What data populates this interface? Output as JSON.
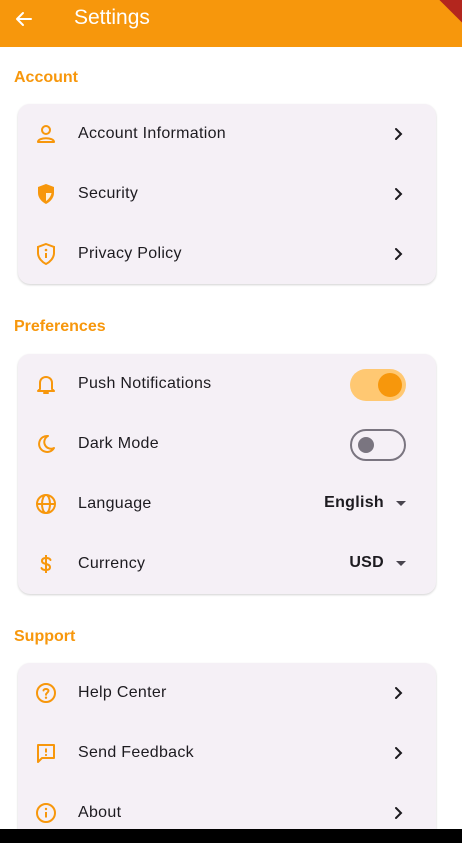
{
  "appbar": {
    "title": "Settings",
    "back_icon": "arrow-left-icon"
  },
  "colors": {
    "accent": "#f7970c",
    "card": "#f5f0f6",
    "text": "#1d1b20",
    "toggle_on_track": "#ffc872"
  },
  "sections": {
    "account": {
      "header": "Account",
      "items": [
        {
          "label": "Account Information",
          "icon": "person-outline-icon"
        },
        {
          "label": "Security",
          "icon": "shield-icon"
        },
        {
          "label": "Privacy Policy",
          "icon": "privacy-shield-icon"
        }
      ]
    },
    "preferences": {
      "header": "Preferences",
      "items": [
        {
          "label": "Push Notifications",
          "icon": "bell-icon",
          "toggle": true
        },
        {
          "label": "Dark Mode",
          "icon": "moon-icon",
          "toggle": false
        },
        {
          "label": "Language",
          "icon": "globe-icon",
          "value": "English"
        },
        {
          "label": "Currency",
          "icon": "dollar-icon",
          "value": "USD"
        }
      ]
    },
    "support": {
      "header": "Support",
      "items": [
        {
          "label": "Help Center",
          "icon": "help-circle-icon"
        },
        {
          "label": "Send Feedback",
          "icon": "feedback-icon"
        },
        {
          "label": "About",
          "icon": "info-icon"
        }
      ]
    }
  }
}
